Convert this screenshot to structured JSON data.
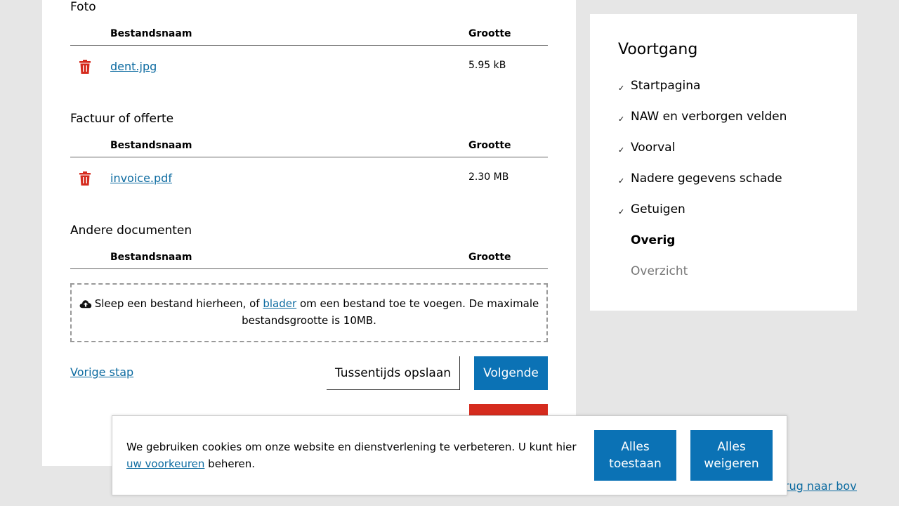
{
  "sections": [
    {
      "title": "Foto",
      "col_name": "Bestandsnaam",
      "col_size": "Grootte",
      "files": [
        {
          "name": "dent.jpg",
          "size": "5.95 kB"
        }
      ]
    },
    {
      "title": "Factuur of offerte",
      "col_name": "Bestandsnaam",
      "col_size": "Grootte",
      "files": [
        {
          "name": "invoice.pdf",
          "size": "2.30 MB"
        }
      ]
    },
    {
      "title": "Andere documenten",
      "col_name": "Bestandsnaam",
      "col_size": "Grootte",
      "files": []
    }
  ],
  "dropzone": {
    "text_before": "Sleep een bestand hierheen, of ",
    "link": "blader",
    "text_after": " om een bestand toe te voegen. De maximale bestandsgrootte is 10MB."
  },
  "nav": {
    "prev": "Vorige stap",
    "save": "Tussentijds opslaan",
    "next": "Volgende"
  },
  "progress": {
    "title": "Voortgang",
    "steps": [
      {
        "label": "Startpagina",
        "status": "done"
      },
      {
        "label": "NAW en verborgen velden",
        "status": "done"
      },
      {
        "label": "Voorval",
        "status": "done"
      },
      {
        "label": "Nadere gegevens schade",
        "status": "done"
      },
      {
        "label": "Getuigen",
        "status": "done"
      },
      {
        "label": "Overig",
        "status": "current"
      },
      {
        "label": "Overzicht",
        "status": "todo"
      }
    ],
    "check_glyph": "✓"
  },
  "back_to_top": "Terug naar boven",
  "cookie": {
    "text_before": "We gebruiken cookies om onze website en dienstverlening te verbeteren. U kunt hier ",
    "link": "uw voorkeuren",
    "text_after": " beheren.",
    "accept": "Alles toestaan",
    "reject": "Alles weigeren"
  },
  "colors": {
    "primary": "#0b72b5",
    "link": "#0b6aa0",
    "danger": "#d52b1e",
    "background": "#e6e6e6"
  },
  "icons": {
    "delete": "trash-icon",
    "upload": "cloud-upload-icon",
    "done": "check-icon"
  }
}
